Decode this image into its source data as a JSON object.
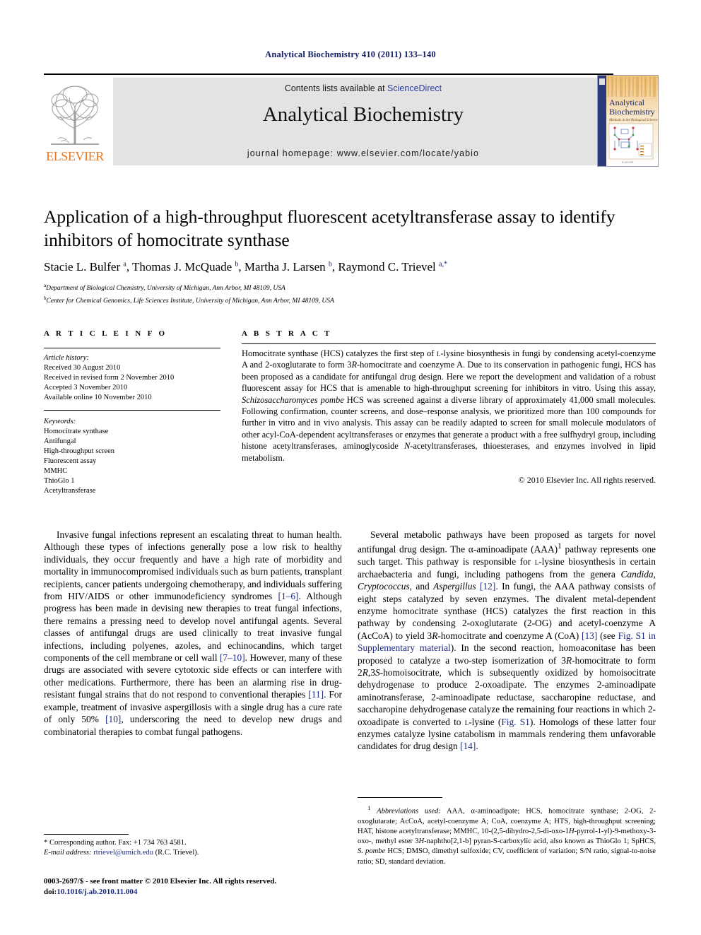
{
  "running_head": "Analytical Biochemistry 410 (2011) 133–140",
  "masthead": {
    "publisher": "ELSEVIER",
    "contents_prefix": "Contents lists available at ",
    "sciencedirect": "ScienceDirect",
    "journal_title": "Analytical Biochemistry",
    "homepage": "journal homepage: www.elsevier.com/locate/yabio",
    "cover_title_line1": "Analytical",
    "cover_title_line2": "Biochemistry",
    "cover_subtitle": "Methods in the Biological Sciences",
    "accent_orange": "#E87722",
    "link_blue": "#2b3f9e",
    "banner_gray": "#e3e3e3"
  },
  "article": {
    "title": "Application of a high-throughput fluorescent acetyltransferase assay to identify inhibitors of homocitrate synthase",
    "authors_html": "Stacie L. Bulfer <sup>a</sup>, Thomas J. McQuade <sup>b</sup>, Martha J. Larsen <sup>b</sup>, Raymond C. Trievel <sup>a,*</sup>",
    "affiliations": [
      {
        "mark": "a",
        "text": "Department of Biological Chemistry, University of Michigan, Ann Arbor, MI 48109, USA"
      },
      {
        "mark": "b",
        "text": "Center for Chemical Genomics, Life Sciences Institute, University of Michigan, Ann Arbor, MI 48109, USA"
      }
    ]
  },
  "info": {
    "heading": "A R T I C L E    I N F O",
    "history_label": "Article history:",
    "history": [
      "Received 30 August 2010",
      "Received in revised form 2 November 2010",
      "Accepted 3 November 2010",
      "Available online 10 November 2010"
    ],
    "keywords_label": "Keywords:",
    "keywords": [
      "Homocitrate synthase",
      "Antifungal",
      "High-throughput screen",
      "Fluorescent assay",
      "MMHC",
      "ThioGlo 1",
      "Acetyltransferase"
    ]
  },
  "abstract": {
    "heading": "A B S T R A C T",
    "text_html": "Homocitrate synthase (HCS) catalyzes the first step of <span class=\"sc\">l</span>-lysine biosynthesis in fungi by condensing acetyl-coenzyme A and 2-oxoglutarate to form 3<i>R</i>-homocitrate and coenzyme A. Due to its conservation in pathogenic fungi, HCS has been proposed as a candidate for antifungal drug design. Here we report the development and validation of a robust fluorescent assay for HCS that is amenable to high-throughput screening for inhibitors in vitro. Using this assay, <i>Schizosaccharomyces pombe</i> HCS was screened against a diverse library of approximately 41,000 small molecules. Following confirmation, counter screens, and dose–response analysis, we prioritized more than 100 compounds for further in vitro and in vivo analysis. This assay can be readily adapted to screen for small molecule modulators of other acyl-CoA-dependent acyltransferases or enzymes that generate a product with a free sulfhydryl group, including histone acetyltransferases, aminoglycoside <i>N</i>-acetyltransferases, thioesterases, and enzymes involved in lipid metabolism.",
    "copyright": "© 2010 Elsevier Inc. All rights reserved."
  },
  "body": {
    "left_html": "Invasive fungal infections represent an escalating threat to human health. Although these types of infections generally pose a low risk to healthy individuals, they occur frequently and have a high rate of morbidity and mortality in immunocompromised individuals such as burn patients, transplant recipients, cancer patients undergoing chemotherapy, and individuals suffering from HIV/AIDS or other immunodeficiency syndromes <span class=\"ref\">[1–6]</span>. Although progress has been made in devising new therapies to treat fungal infections, there remains a pressing need to develop novel antifungal agents. Several classes of antifungal drugs are used clinically to treat invasive fungal infections, including polyenes, azoles, and echinocandins, which target components of the cell membrane or cell wall <span class=\"ref\">[7–10]</span>. However, many of these drugs are associated with severe cytotoxic side effects or can interfere with other medications. Furthermore, there has been an alarming rise in drug-resistant fungal strains that do not respond to conventional therapies <span class=\"ref\">[11]</span>. For example, treatment of invasive aspergillosis with a single drug has a cure rate of only 50% <span class=\"ref\">[10]</span>, underscoring the need to develop new drugs and combinatorial therapies to combat fungal pathogens.",
    "right_html": "Several metabolic pathways have been proposed as targets for novel antifungal drug design. The α-aminoadipate (AAA)<sup>1</sup> pathway represents one such target. This pathway is responsible for <span class=\"sc\">l</span>-lysine biosynthesis in certain archaebacteria and fungi, including pathogens from the genera <i>Candida</i>, <i>Cryptococcus</i>, and <i>Aspergillus</i> <span class=\"ref\">[12]</span>. In fungi, the AAA pathway consists of eight steps catalyzed by seven enzymes. The divalent metal-dependent enzyme homocitrate synthase (HCS) catalyzes the first reaction in this pathway by condensing 2-oxoglutarate (2-OG) and acetyl-coenzyme A (AcCoA) to yield 3<i>R</i>-homocitrate and coenzyme A (CoA) <span class=\"ref\">[13]</span> (see <span class=\"lnk\">Fig. S1 in Supplementary material</span>). In the second reaction, homoaconitase has been proposed to catalyze a two-step isomerization of 3<i>R</i>-homocitrate to form 2<i>R</i>,3<i>S</i>-homoisocitrate, which is subsequently oxidized by homoisocitrate dehydrogenase to produce 2-oxoadipate. The enzymes 2-aminoadipate aminotransferase, 2-aminoadipate reductase, saccharopine reductase, and saccharopine dehydrogenase catalyze the remaining four reactions in which 2-oxoadipate is converted to <span class=\"sc\">l</span>-lysine (<span class=\"lnk\">Fig. S1</span>). Homologs of these latter four enzymes catalyze lysine catabolism in mammals rendering them unfavorable candidates for drug design <span class=\"ref\">[14]</span>."
  },
  "footnotes": {
    "corresponding_html": "* Corresponding author. Fax: +1 734 763 4581.",
    "email_label": "E-mail address:",
    "email": "rtrievel@umich.edu",
    "email_suffix": "(R.C. Trievel).",
    "imprint_line1": "0003-2697/$ - see front matter © 2010 Elsevier Inc. All rights reserved.",
    "imprint_doi_label": "doi:",
    "imprint_doi": "10.1016/j.ab.2010.11.004",
    "abbreviations_html": "<sup>1</sup> <i>Abbreviations used:</i> AAA, α-aminoadipate; HCS, homocitrate synthase; 2-OG, 2-oxoglutarate; AcCoA, acetyl-coenzyme A; CoA, coenzyme A; HTS, high-throughput screening; HAT, histone acetyltransferase; MMHC, 10-(2,5-dihydro-2,5-di-oxo-1<i>H</i>-pyrrol-1-yl)-9-methoxy-3-oxo-, methyl ester 3<i>H</i>-naphtho[2,1-b] pyran-S-carboxylic acid, also known as ThioGlo 1; SpHCS, <i>S. pombe</i> HCS; DMSO, dimethyl sulfoxide; CV, coefficient of variation; S/N ratio, signal-to-noise ratio; SD, standard deviation."
  }
}
